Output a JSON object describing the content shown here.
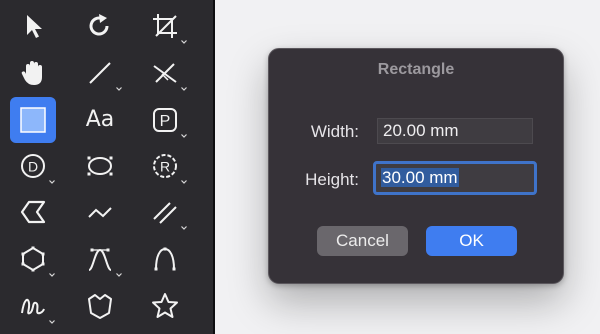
{
  "palette": {
    "tools": [
      {
        "name": "arrow-pointer",
        "selected": false
      },
      {
        "name": "rotate",
        "selected": false
      },
      {
        "name": "crop",
        "selected": false
      },
      {
        "name": "hand",
        "selected": false
      },
      {
        "name": "line",
        "selected": false
      },
      {
        "name": "angle-measure",
        "selected": false
      },
      {
        "name": "rectangle",
        "selected": true
      },
      {
        "name": "text",
        "selected": false,
        "label": "Aa"
      },
      {
        "name": "parking-symbol",
        "selected": false,
        "label": "P"
      },
      {
        "name": "d-symbol",
        "selected": false,
        "label": "D"
      },
      {
        "name": "ellipse",
        "selected": false
      },
      {
        "name": "circle-radius",
        "selected": false,
        "label": "R"
      },
      {
        "name": "arrow-shape",
        "selected": false
      },
      {
        "name": "polyline",
        "selected": false
      },
      {
        "name": "double-line",
        "selected": false
      },
      {
        "name": "polygon",
        "selected": false
      },
      {
        "name": "bezier-curve",
        "selected": false
      },
      {
        "name": "arc",
        "selected": false
      },
      {
        "name": "freehand",
        "selected": false
      },
      {
        "name": "shield-shape",
        "selected": false
      },
      {
        "name": "star",
        "selected": false
      }
    ]
  },
  "dialog": {
    "title": "Rectangle",
    "width_label": "Width:",
    "width_value": "20.00 mm",
    "height_label": "Height:",
    "height_value": "30.00 mm",
    "cancel_label": "Cancel",
    "ok_label": "OK"
  },
  "colors": {
    "palette_bg": "#2b2a2e",
    "accent": "#3f7df0",
    "dialog_bg": "#363238"
  }
}
